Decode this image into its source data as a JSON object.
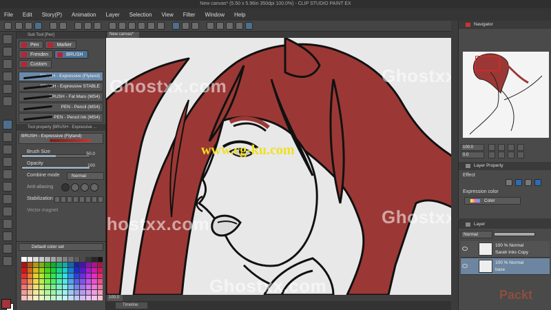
{
  "window": {
    "title": "New canvas* (5.50 x 5.96in 350dpi 100.0%) - CLIP STUDIO PAINT EX"
  },
  "menu": [
    "File",
    "Edit",
    "Story(P)",
    "Animation",
    "Layer",
    "Selection",
    "View",
    "Filter",
    "Window",
    "Help"
  ],
  "subtool": {
    "title": "Sub Tool [Pen]",
    "tabs": [
      "Pen",
      "Marker",
      "Frenden",
      "BRUSH",
      "Custom"
    ],
    "active_tab": "BRUSH",
    "brushes": [
      "BRUSH - Expressive (Flyland)",
      "BRUSH - Expressive STABLE",
      "BRUSH - Fat Maru (MS4)",
      "PEN - Pencil (MS4)",
      "PEN - Pencil Ink (MS4)"
    ]
  },
  "tool_property": {
    "title": "Tool property [BRUSH - Expressive ...",
    "brush_name": "BRUSH - Expressive (Flyland)",
    "brush_size_label": "Brush Size",
    "brush_size_value": "50.0",
    "brush_size_pct": 50,
    "opacity_label": "Opacity",
    "opacity_value": "100",
    "opacity_pct": 100,
    "combine_mode_label": "Combine mode",
    "combine_mode_value": "Normal",
    "anti_aliasing_label": "Anti-aliasing",
    "stabilization_label": "Stabilization",
    "vector_magnet_label": "Vector magnet"
  },
  "colorset": {
    "title": "Default color set"
  },
  "canvas": {
    "tab_label": "New canvas*",
    "watermark": "Ghostxx.com",
    "site_url": "www.cg-ku.com",
    "zoom": "100.0",
    "timeline_label": "Timeline"
  },
  "navigator": {
    "title": "Navigator",
    "zoom": "100.0",
    "rotation": "0.0"
  },
  "layer_property": {
    "title": "Layer Property",
    "effect_label": "Effect",
    "expression_color_label": "Expression color",
    "expression_color_value": "Color"
  },
  "layers": {
    "title": "Layer",
    "blend": "Normal",
    "opacity_pct": 100,
    "rows": [
      {
        "line1": "100 %  Normal",
        "line2": "Sarah Inks Copy",
        "selected": false
      },
      {
        "line1": "100 %  Normal",
        "line2": "base",
        "selected": true
      }
    ]
  },
  "colors": {
    "main_color": "#a3343a",
    "sub_color": "#ffffff",
    "hair": "#9b3835",
    "accent": "#4e7599"
  },
  "logo": "Packt"
}
